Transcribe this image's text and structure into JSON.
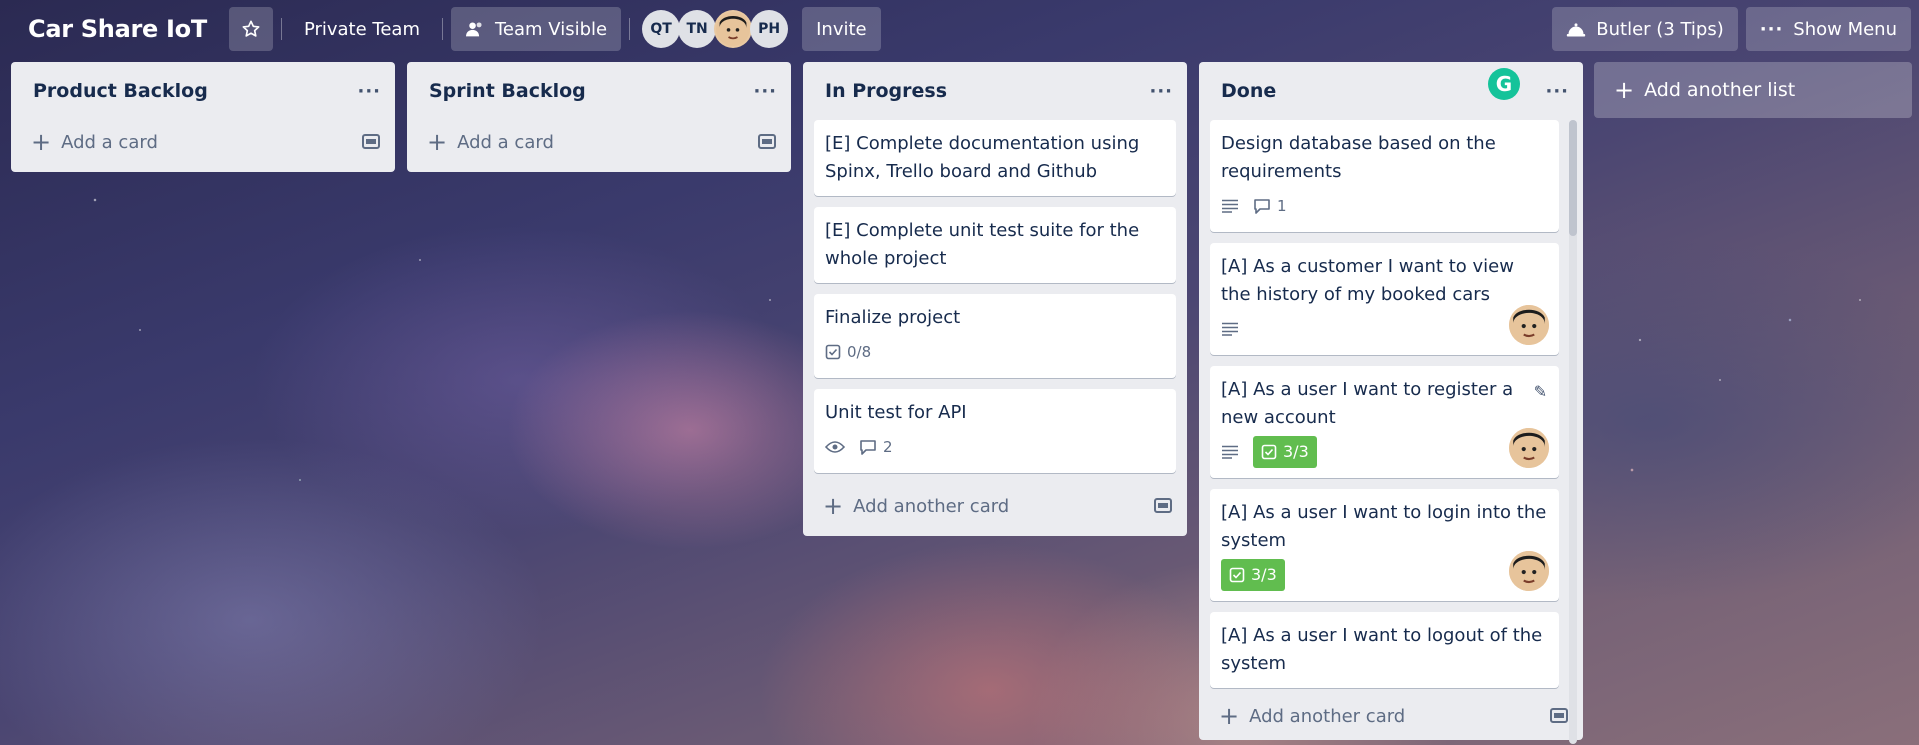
{
  "header": {
    "board_title": "Car Share IoT",
    "team_label": "Private Team",
    "visibility_label": "Team Visible",
    "members": [
      "QT",
      "TN",
      "",
      "PH"
    ],
    "invite_label": "Invite",
    "butler_label": "Butler (3 Tips)",
    "menu_label": "Show Menu"
  },
  "lists": [
    {
      "title": "Product Backlog",
      "add_label": "Add a card"
    },
    {
      "title": "Sprint Backlog",
      "add_label": "Add a card"
    },
    {
      "title": "In Progress",
      "add_label": "Add another card",
      "cards": [
        {
          "title": "[E] Complete documentation using Spinx, Trello board and Github"
        },
        {
          "title": "[E] Complete unit test suite for the whole project"
        },
        {
          "title": "Finalize project",
          "checklist": "0/8"
        },
        {
          "title": "Unit test for API",
          "comments": "2"
        }
      ]
    },
    {
      "title": "Done",
      "add_label": "Add another card",
      "cards": [
        {
          "title": "Design database based on the requirements",
          "comments": "1"
        },
        {
          "title": "[A] As a customer I want to view the history of my booked cars"
        },
        {
          "title": "[A] As a user I want to register a new account",
          "checklist": "3/3"
        },
        {
          "title": "[A] As a user I want to login into the system",
          "checklist": "3/3"
        },
        {
          "title": "[A] As a user I want to logout of the system"
        }
      ]
    }
  ],
  "add_list_label": "Add another list",
  "colors": {
    "list_bg": "#ebecf0",
    "checklist_complete": "#61bd4f",
    "grammarly": "#15c39a"
  }
}
